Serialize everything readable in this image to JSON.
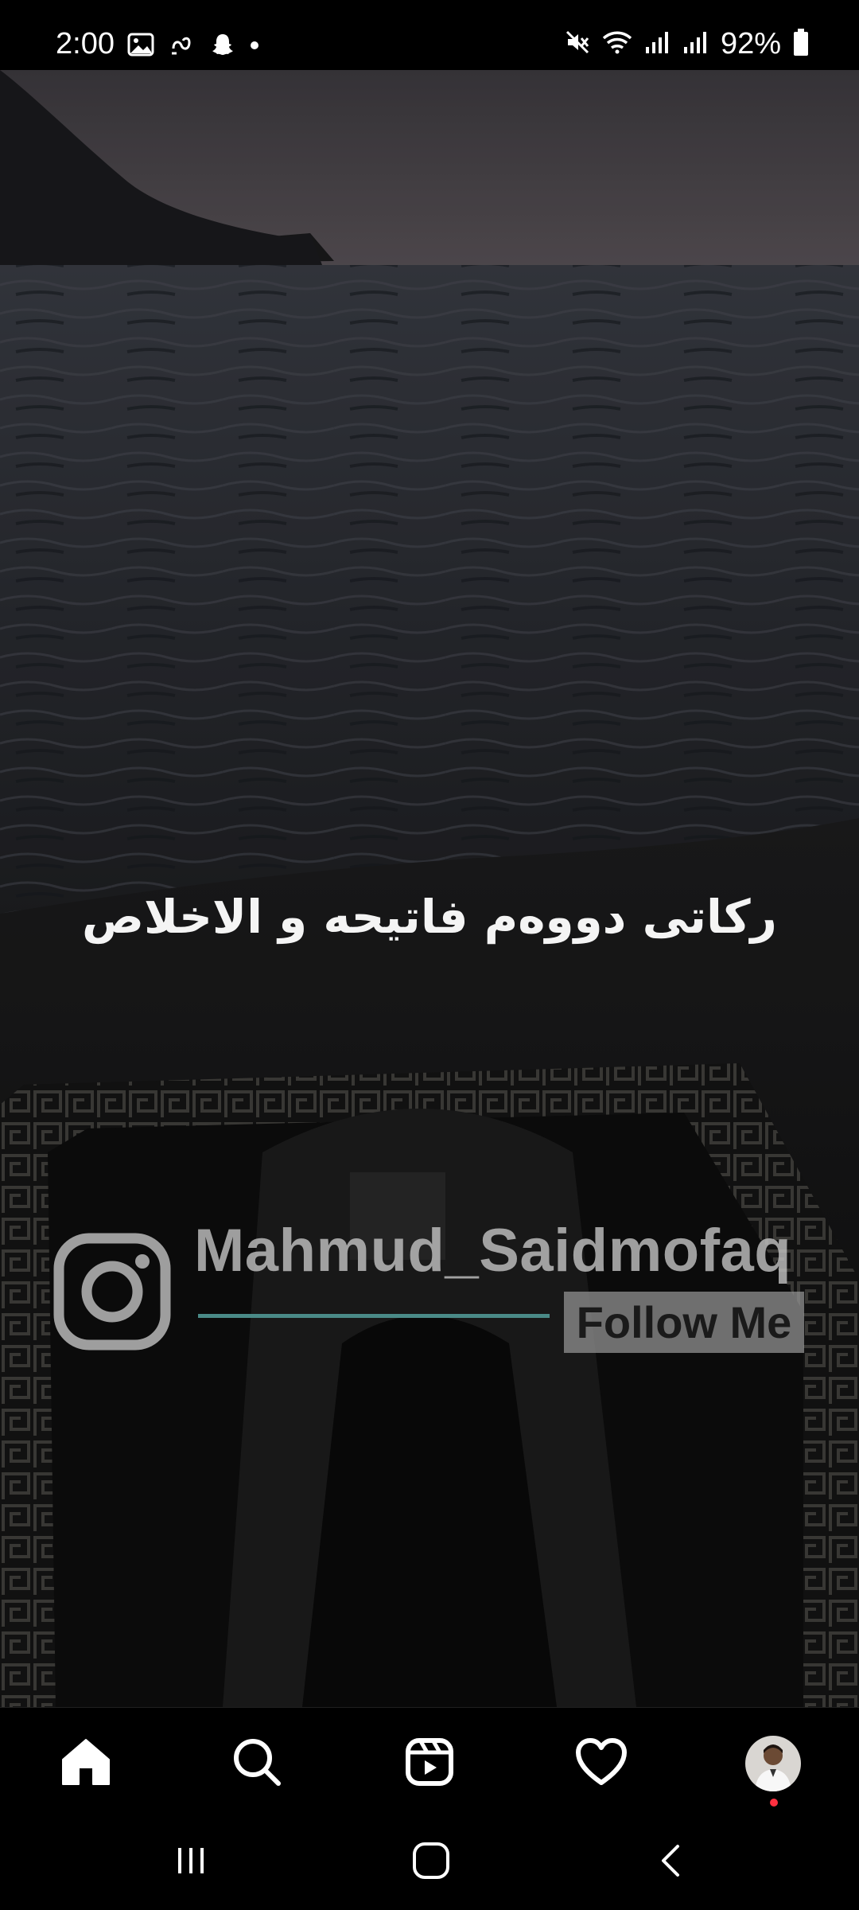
{
  "status_bar": {
    "time": "2:00",
    "left_icons": [
      "gallery-icon",
      "link-icon",
      "snapchat-icon",
      "dot-icon"
    ],
    "right_icons": [
      "mute-icon",
      "wifi-icon",
      "signal-icon",
      "signal-icon",
      "battery-icon"
    ],
    "battery": "92%"
  },
  "post": {
    "caption": "ركاتى دووەم فاتيحه و الاخلاص",
    "watermark": {
      "handle": "Mahmud_Saidmofaq",
      "follow_label": "Follow Me"
    }
  },
  "bottom_nav": {
    "items": [
      "home-icon",
      "search-icon",
      "reels-icon",
      "heart-icon",
      "profile-avatar"
    ],
    "has_notification": true,
    "notification_color": "#ff3040"
  },
  "system_nav": {
    "buttons": [
      "recents-button",
      "home-button",
      "back-button"
    ]
  }
}
